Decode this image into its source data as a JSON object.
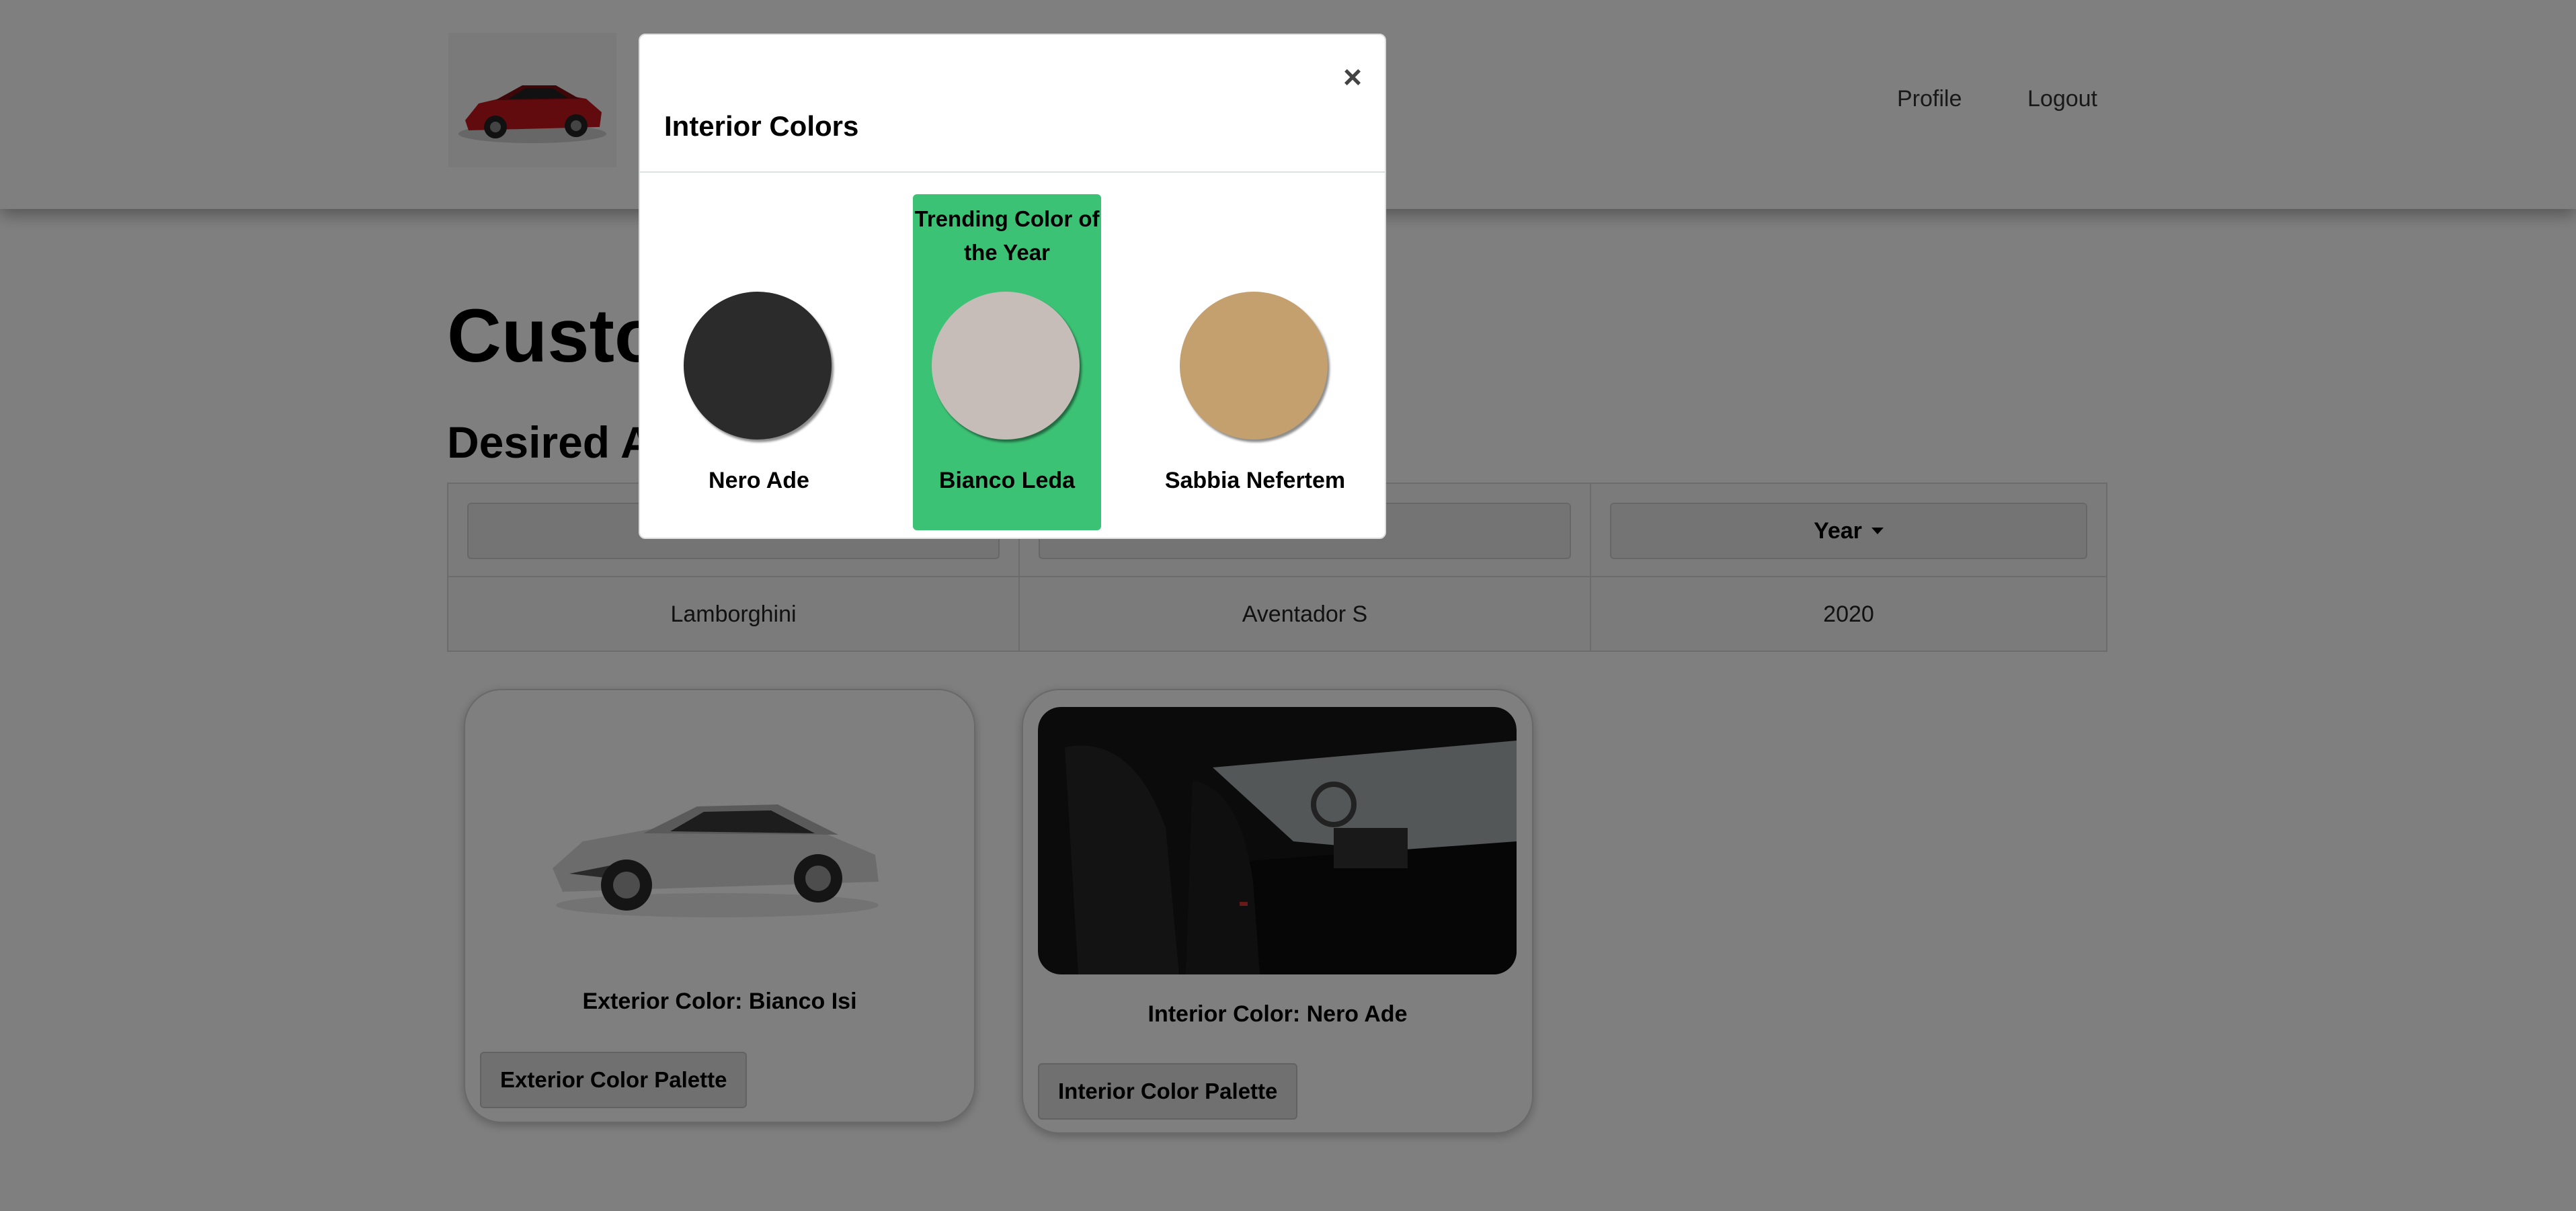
{
  "nav": {
    "profile": "Profile",
    "logout": "Logout"
  },
  "main": {
    "title_visible": "Custo",
    "section_visible": "Desired A",
    "specs": {
      "year_label": "Year",
      "make": "Lamborghini",
      "model": "Aventador S",
      "year": "2020"
    },
    "exterior_card": {
      "caption": "Exterior Color: Bianco Isi",
      "button": "Exterior Color Palette"
    },
    "interior_card": {
      "caption": "Interior Color: Nero Ade",
      "button": "Interior Color Palette"
    }
  },
  "modal": {
    "title": "Interior Colors",
    "close": "×",
    "trending_label": "Trending Color of the Year",
    "colors": [
      {
        "name": "Nero Ade",
        "hex": "#2b2b2b"
      },
      {
        "name": "Bianco Leda",
        "hex": "#c7bdb8"
      },
      {
        "name": "Sabbia Nefertem",
        "hex": "#c4a06e"
      }
    ]
  },
  "colors": {
    "overlay": "rgba(0,0,0,0.5)",
    "trending_bg": "#3cc275"
  }
}
